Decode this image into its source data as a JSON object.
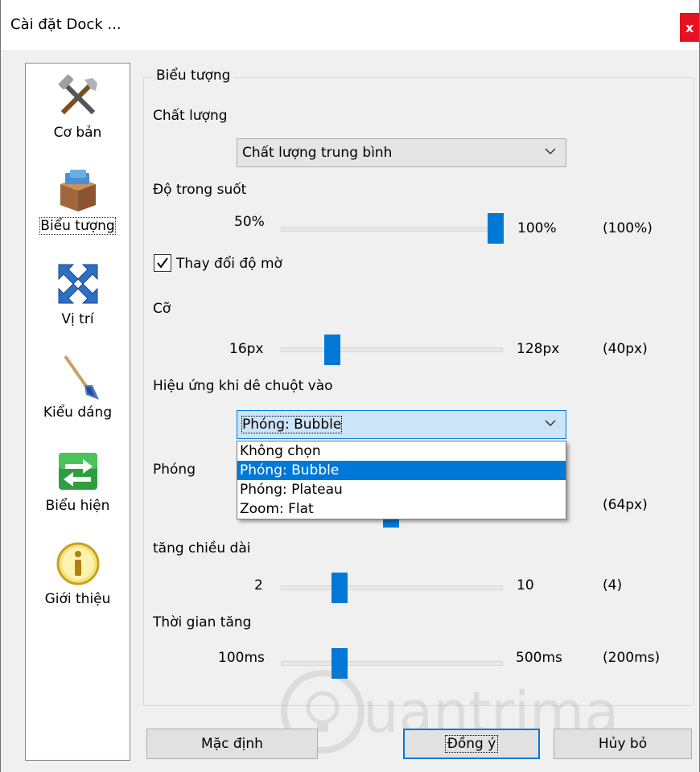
{
  "window": {
    "title": "Cài đặt Dock ...",
    "close_label": "x"
  },
  "sidebar": {
    "items": [
      {
        "label": "Cơ bản",
        "icon": "tools-icon"
      },
      {
        "label": "Biểu tượng",
        "icon": "box-icon",
        "active": true
      },
      {
        "label": "Vị trí",
        "icon": "move-arrows-icon"
      },
      {
        "label": "Kiểu dáng",
        "icon": "brush-icon"
      },
      {
        "label": "Biểu hiện",
        "icon": "swap-arrows-icon"
      },
      {
        "label": "Giới thiệu",
        "icon": "info-icon"
      }
    ]
  },
  "group": {
    "legend": "Biểu tượng",
    "quality": {
      "label": "Chất lượng",
      "value": "Chất lượng trung bình"
    },
    "opacity": {
      "label": "Độ trong suốt",
      "min": "50%",
      "max": "100%",
      "current": "(100%)",
      "level": 1.0
    },
    "checkbox": {
      "label": "Thay đổi độ mờ",
      "checked": true
    },
    "size": {
      "label": "Cỡ",
      "min": "16px",
      "max": "128px",
      "current": "(40px)",
      "level": 0.21
    },
    "hover_effect": {
      "label": "Hiệu ứng khi dê chuột vào",
      "value": "Phóng: Bubble",
      "options": [
        "Không chọn",
        "Phóng: Bubble",
        "Phóng: Plateau",
        "Zoom: Flat"
      ],
      "selected_index": 1
    },
    "zoom": {
      "label": "Phóng",
      "current": "(64px)"
    },
    "length": {
      "label": "tăng chiều dài",
      "min": "2",
      "max": "10",
      "current": "(4)",
      "level": 0.25
    },
    "time": {
      "label": "Thời gian tăng",
      "min": "100ms",
      "max": "500ms",
      "current": "(200ms)",
      "level": 0.25
    }
  },
  "buttons": {
    "default_label": "Mặc định",
    "ok_label": "Đồng ý",
    "cancel_label": "Hủy bỏ"
  },
  "watermark": {
    "text": "uantrimang"
  },
  "colors": {
    "accent": "#0078d7",
    "close": "#e81123"
  }
}
